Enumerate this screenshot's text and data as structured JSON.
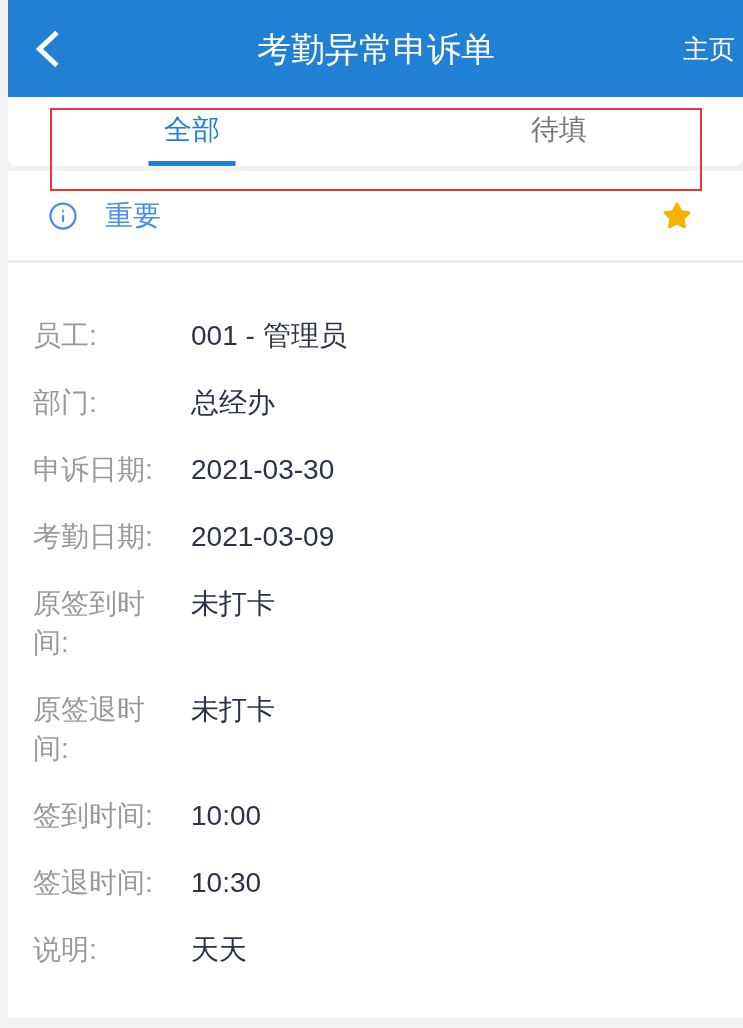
{
  "header": {
    "title": "考勤异常申诉单",
    "home_link": "主页"
  },
  "tabs": [
    {
      "label": "全部",
      "selected": true
    },
    {
      "label": "待填",
      "selected": false
    }
  ],
  "notice": {
    "label": "重要",
    "starred": true
  },
  "fields": [
    {
      "label": "员工:",
      "value": "001 - 管理员"
    },
    {
      "label": "部门:",
      "value": "总经办"
    },
    {
      "label": "申诉日期:",
      "value": "2021-03-30"
    },
    {
      "label": "考勤日期:",
      "value": "2021-03-09"
    },
    {
      "label": "原签到时间:",
      "value": "未打卡"
    },
    {
      "label": "原签退时间:",
      "value": "未打卡"
    },
    {
      "label": "签到时间:",
      "value": "10:00"
    },
    {
      "label": "签退时间:",
      "value": "10:30"
    },
    {
      "label": "说明:",
      "value": "天天"
    }
  ]
}
